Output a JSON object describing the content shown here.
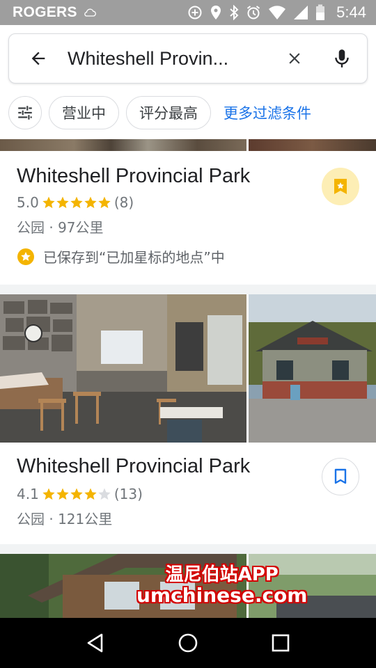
{
  "status_bar": {
    "carrier": "ROGERS",
    "time": "5:44",
    "icons": [
      "cloud-icon",
      "data-saver-icon",
      "location-icon",
      "bluetooth-icon",
      "alarm-icon",
      "wifi-icon",
      "signal-icon",
      "battery-icon"
    ]
  },
  "search": {
    "query": "Whiteshell Provin...",
    "back_icon": "arrow-left-icon",
    "clear_icon": "close-icon",
    "mic_icon": "mic-icon"
  },
  "filters": {
    "settings_icon": "sliders-icon",
    "chips": [
      "营业中",
      "评分最高"
    ],
    "more": "更多过滤条件"
  },
  "results": [
    {
      "title": "Whiteshell Provincial Park",
      "rating": "5.0",
      "stars": 5,
      "reviews": "(8)",
      "category_distance": "公园 · 97公里",
      "saved_text": "已保存到“已加星标的地点”中",
      "saved": true
    },
    {
      "title": "Whiteshell Provincial Park",
      "rating": "4.1",
      "stars": 4,
      "reviews": "(13)",
      "category_distance": "公园 · 121公里",
      "saved": false
    }
  ],
  "watermark": {
    "line1": "温尼伯站APP",
    "line2": "umchinese.com"
  },
  "colors": {
    "accent": "#1a73e8",
    "star": "#f4b400",
    "saved_bg": "#fdeeb5",
    "status_bar": "#9e9e9e"
  },
  "nav": [
    "back-triangle-icon",
    "home-circle-icon",
    "recents-square-icon"
  ]
}
